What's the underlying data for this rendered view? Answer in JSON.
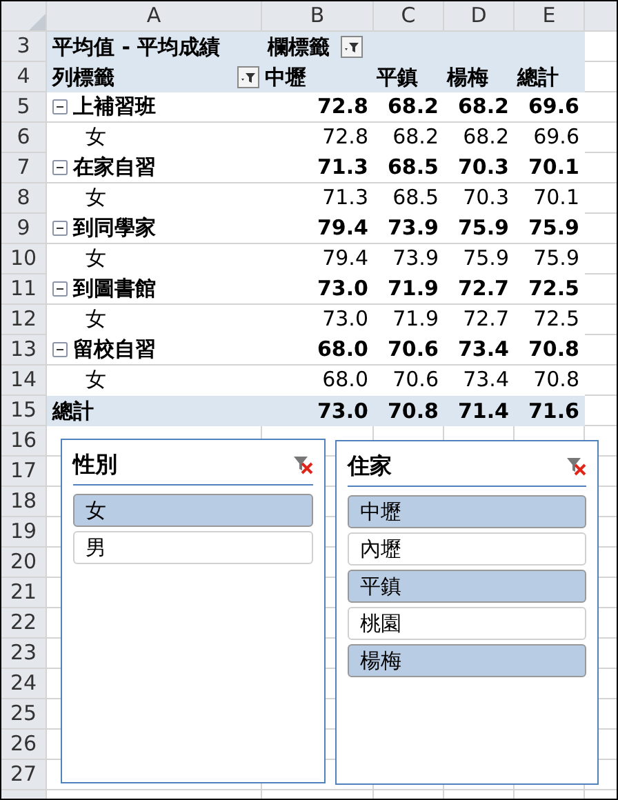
{
  "column_headers": [
    "A",
    "B",
    "C",
    "D",
    "E"
  ],
  "pivot_title_row": {
    "row_number": "3",
    "value_label": "平均值 - 平均成績",
    "column_label": "欄標籤"
  },
  "pivot_header_row": {
    "row_number": "4",
    "row_label": "列標籤",
    "columns": [
      "中壢",
      "平鎮",
      "楊梅",
      "總計"
    ]
  },
  "rows": [
    {
      "row_number": "5",
      "kind": "group",
      "expanded": true,
      "label": "上補習班",
      "values": [
        "72.8",
        "68.2",
        "68.2",
        "69.6"
      ]
    },
    {
      "row_number": "6",
      "kind": "item",
      "label": "女",
      "values": [
        "72.8",
        "68.2",
        "68.2",
        "69.6"
      ]
    },
    {
      "row_number": "7",
      "kind": "group",
      "expanded": true,
      "label": "在家自習",
      "values": [
        "71.3",
        "68.5",
        "70.3",
        "70.1"
      ]
    },
    {
      "row_number": "8",
      "kind": "item",
      "label": "女",
      "values": [
        "71.3",
        "68.5",
        "70.3",
        "70.1"
      ]
    },
    {
      "row_number": "9",
      "kind": "group",
      "expanded": true,
      "label": "到同學家",
      "values": [
        "79.4",
        "73.9",
        "75.9",
        "75.9"
      ]
    },
    {
      "row_number": "10",
      "kind": "item",
      "label": "女",
      "values": [
        "79.4",
        "73.9",
        "75.9",
        "75.9"
      ]
    },
    {
      "row_number": "11",
      "kind": "group",
      "expanded": true,
      "label": "到圖書館",
      "values": [
        "73.0",
        "71.9",
        "72.7",
        "72.5"
      ]
    },
    {
      "row_number": "12",
      "kind": "item",
      "label": "女",
      "values": [
        "73.0",
        "71.9",
        "72.7",
        "72.5"
      ]
    },
    {
      "row_number": "13",
      "kind": "group",
      "expanded": true,
      "label": "留校自習",
      "values": [
        "68.0",
        "70.6",
        "73.4",
        "70.8"
      ]
    },
    {
      "row_number": "14",
      "kind": "item",
      "label": "女",
      "values": [
        "68.0",
        "70.6",
        "73.4",
        "70.8"
      ]
    },
    {
      "row_number": "15",
      "kind": "total",
      "label": "總計",
      "values": [
        "73.0",
        "70.8",
        "71.4",
        "71.6"
      ]
    }
  ],
  "empty_row_numbers": [
    "16",
    "17",
    "18",
    "19",
    "20",
    "21",
    "22",
    "23",
    "24",
    "25",
    "26",
    "27"
  ],
  "slicers": [
    {
      "title": "性別",
      "items": [
        {
          "label": "女",
          "selected": true
        },
        {
          "label": "男",
          "selected": false
        }
      ]
    },
    {
      "title": "住家",
      "items": [
        {
          "label": "中壢",
          "selected": true
        },
        {
          "label": "內壢",
          "selected": false
        },
        {
          "label": "平鎮",
          "selected": true
        },
        {
          "label": "桃園",
          "selected": false
        },
        {
          "label": "楊梅",
          "selected": true
        }
      ]
    }
  ]
}
